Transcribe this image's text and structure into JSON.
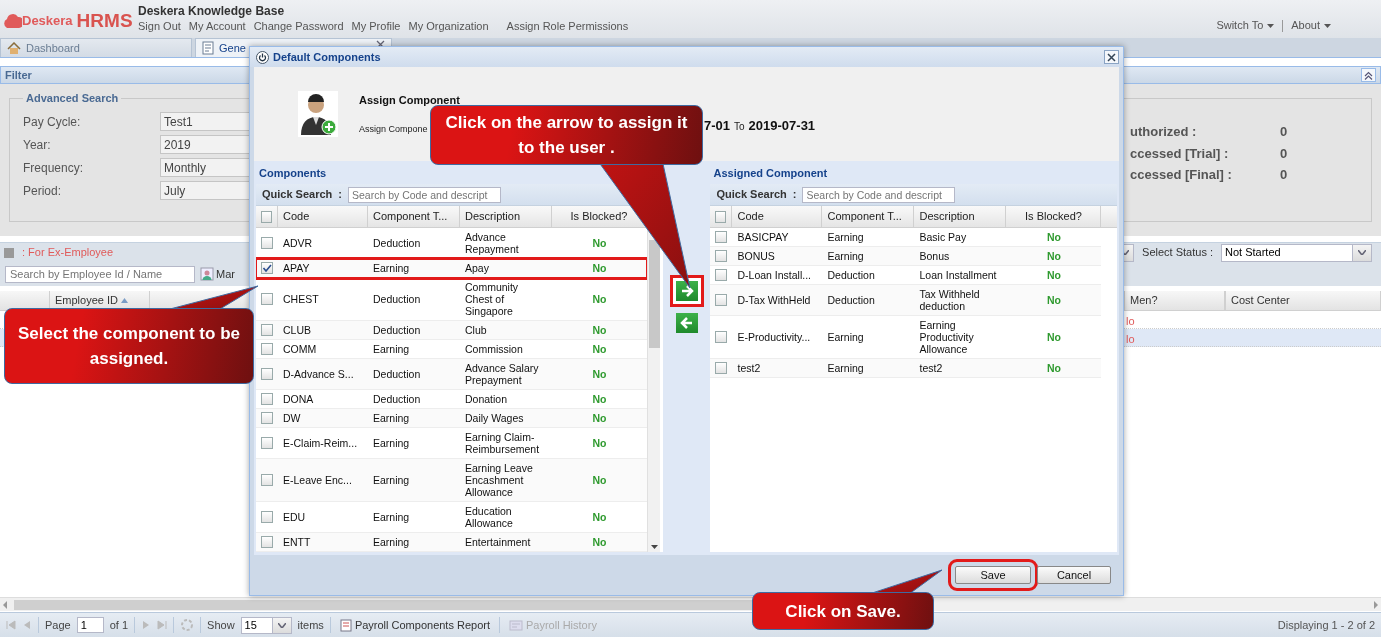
{
  "app": {
    "logo_brand": "Deskera",
    "logo_product": "HRMS",
    "site_title": "Deskera Knowledge Base",
    "account_links": [
      "Sign Out",
      "My Account",
      "Change Password",
      "My Profile",
      "My Organization",
      "Assign Role Permissions"
    ],
    "right_menus": [
      "Switch To",
      "About"
    ]
  },
  "tabs": [
    {
      "label": "Dashboard",
      "selected": false
    },
    {
      "label": "Gene",
      "selected": true
    }
  ],
  "filter": {
    "title": "Filter",
    "section": "Advanced Search",
    "fields": [
      {
        "label": "Pay Cycle:",
        "value": "Test1"
      },
      {
        "label": "Year:",
        "value": "2019"
      },
      {
        "label": "Frequency:",
        "value": "Monthly"
      },
      {
        "label": "Period:",
        "value": "July"
      }
    ],
    "summary": [
      {
        "label": "uthorized :",
        "value": "0"
      },
      {
        "label": "ccessed [Trial] :",
        "value": "0"
      },
      {
        "label": "ccessed [Final] :",
        "value": "0"
      }
    ]
  },
  "toolbar": {
    "legend": ": For Ex-Employee",
    "status_label": "Select Status :",
    "status_value": "Not Started",
    "search_placeholder": "Search by Employee Id / Name",
    "button_label": "Mar"
  },
  "grid": {
    "columns": [
      "Employee ID"
    ],
    "right_columns": [
      "Men?",
      "Cost Center"
    ],
    "rows": [
      {
        "cell": "lo",
        "selected": false
      },
      {
        "cell": "lo",
        "selected": true
      }
    ]
  },
  "pager": {
    "page_label": "Page",
    "page": "1",
    "of": "of 1",
    "show": "Show",
    "page_size": "15",
    "items": "items",
    "buttons": [
      {
        "label": "Payroll Components Report",
        "disabled": false
      },
      {
        "label": "Payroll History",
        "disabled": true
      }
    ],
    "display": "Displaying 1 - 2 of 2"
  },
  "dialog": {
    "title": "Default Components",
    "heading": "Assign Component",
    "subtitle": "Assign Compone",
    "period_start": "7-01",
    "period_sep": "To",
    "period_end": "2019-07-31",
    "panels": [
      {
        "title": "Components",
        "search_label": "Quick Search",
        "search_sep": ":",
        "search_placeholder": "Search by Code and descript",
        "select_all_checked": false,
        "scrollbar": true,
        "columns": [
          "Code",
          "Component T...",
          "Description",
          "Is Blocked?"
        ],
        "rows": [
          {
            "code": "ADVR",
            "type": "Deduction",
            "description": "Advance Repayment",
            "blocked": "No",
            "checked": false,
            "highlighted": false
          },
          {
            "code": "APAY",
            "type": "Earning",
            "description": "Apay",
            "blocked": "No",
            "checked": true,
            "highlighted": true
          },
          {
            "code": "CHEST",
            "type": "Deduction",
            "description": "Community Chest of Singapore",
            "blocked": "No",
            "checked": false,
            "highlighted": false
          },
          {
            "code": "CLUB",
            "type": "Deduction",
            "description": "Club",
            "blocked": "No",
            "checked": false,
            "highlighted": false
          },
          {
            "code": "COMM",
            "type": "Earning",
            "description": "Commission",
            "blocked": "No",
            "checked": false,
            "highlighted": false
          },
          {
            "code": "D-Advance S...",
            "type": "Deduction",
            "description": "Advance Salary Prepayment",
            "blocked": "No",
            "checked": false,
            "highlighted": false
          },
          {
            "code": "DONA",
            "type": "Deduction",
            "description": "Donation",
            "blocked": "No",
            "checked": false,
            "highlighted": false
          },
          {
            "code": "DW",
            "type": "Earning",
            "description": "Daily Wages",
            "blocked": "No",
            "checked": false,
            "highlighted": false
          },
          {
            "code": "E-Claim-Reim...",
            "type": "Earning",
            "description": "Earning Claim-Reimbursement",
            "blocked": "No",
            "checked": false,
            "highlighted": false
          },
          {
            "code": "E-Leave Enc...",
            "type": "Earning",
            "description": "Earning Leave Encashment Allowance",
            "blocked": "No",
            "checked": false,
            "highlighted": false
          },
          {
            "code": "EDU",
            "type": "Earning",
            "description": "Education Allowance",
            "blocked": "No",
            "checked": false,
            "highlighted": false
          },
          {
            "code": "ENTT",
            "type": "Earning",
            "description": "Entertainment",
            "blocked": "No",
            "checked": false,
            "highlighted": false
          }
        ]
      },
      {
        "title": "Assigned Component",
        "search_label": "Quick Search",
        "search_sep": ":",
        "search_placeholder": "Search by Code and descript",
        "select_all_checked": false,
        "scrollbar": false,
        "columns": [
          "Code",
          "Component T...",
          "Description",
          "Is Blocked?"
        ],
        "rows": [
          {
            "code": "BASICPAY",
            "type": "Earning",
            "description": "Basic Pay",
            "blocked": "No",
            "checked": false,
            "highlighted": false
          },
          {
            "code": "BONUS",
            "type": "Earning",
            "description": "Bonus",
            "blocked": "No",
            "checked": false,
            "highlighted": false
          },
          {
            "code": "D-Loan Install...",
            "type": "Deduction",
            "description": "Loan Installment",
            "blocked": "No",
            "checked": false,
            "highlighted": false
          },
          {
            "code": "D-Tax WithHeld",
            "type": "Deduction",
            "description": "Tax Withheld deduction",
            "blocked": "No",
            "checked": false,
            "highlighted": false
          },
          {
            "code": "E-Productivity...",
            "type": "Earning",
            "description": "Earning Productivity Allowance",
            "blocked": "No",
            "checked": false,
            "highlighted": false
          },
          {
            "code": "test2",
            "type": "Earning",
            "description": "test2",
            "blocked": "No",
            "checked": false,
            "highlighted": false
          }
        ]
      }
    ],
    "transfer_buttons": [
      {
        "kind": "assign",
        "highlighted": true
      },
      {
        "kind": "remove",
        "highlighted": false
      }
    ],
    "buttons": [
      {
        "label": "Save",
        "highlighted": true
      },
      {
        "label": "Cancel",
        "highlighted": false
      }
    ]
  },
  "callouts": [
    {
      "text": "Click on the arrow to assign it to the user .",
      "kind": "arrow"
    },
    {
      "text": "Select the component to be assigned.",
      "kind": "select"
    },
    {
      "text": "Click on Save.",
      "kind": "save"
    }
  ]
}
